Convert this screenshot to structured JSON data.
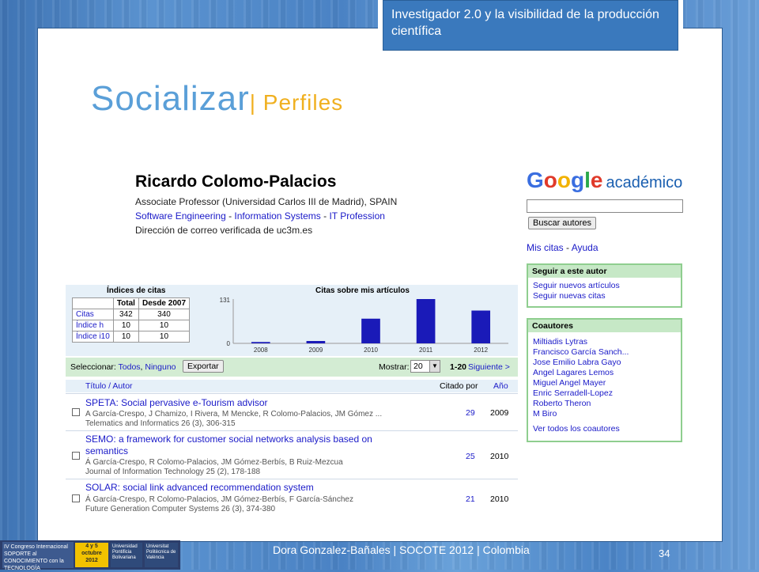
{
  "slide": {
    "header_box": "Investigador 2.0 y la visibilidad de la producción científica",
    "heading_main": "Socializar",
    "heading_sub": "| Perfiles",
    "footer": "Dora Gonzalez-Bañales | SOCOTE 2012 | Colombia",
    "page_number": "34"
  },
  "profile": {
    "name": "Ricardo Colomo-Palacios",
    "affiliation": "Associate Professor (Universidad Carlos III de Madrid), SPAIN",
    "interests": [
      "Software Engineering",
      "Information Systems",
      "IT Profession"
    ],
    "email_verified": "Dirección de correo verificada de uc3m.es"
  },
  "google": {
    "logo_colors": [
      "#3a6ee0",
      "#e03a2a",
      "#f2b200",
      "#3a6ee0",
      "#2aa84a",
      "#e03a2a"
    ],
    "logo_letters": [
      "G",
      "o",
      "o",
      "g",
      "l",
      "e"
    ],
    "logo_suffix": "académico",
    "search_value": "",
    "search_button": "Buscar autores",
    "nav_mis_citas": "Mis citas",
    "nav_sep": "-",
    "nav_ayuda": "Ayuda"
  },
  "follow": {
    "title": "Seguir a este autor",
    "items": [
      "Seguir nuevos artículos",
      "Seguir nuevas citas"
    ]
  },
  "coauthors": {
    "title": "Coautores",
    "items": [
      "Miltiadis Lytras",
      "Francisco García Sanch...",
      "Jose Emilio Labra Gayo",
      "Angel Lagares Lemos",
      "Miguel Angel Mayer",
      "Enric Serradell-Lopez",
      "Roberto Theron",
      "M Biro"
    ],
    "see_all": "Ver todos los coautores"
  },
  "citation_indices": {
    "title": "Índices de citas",
    "headers": [
      "",
      "Total",
      "Desde 2007"
    ],
    "rows": [
      [
        "Citas",
        "342",
        "340"
      ],
      [
        "Índice h",
        "10",
        "10"
      ],
      [
        "Índice i10",
        "10",
        "10"
      ]
    ]
  },
  "chart_data": {
    "type": "bar",
    "title": "Citas sobre mis artículos",
    "categories": [
      "2008",
      "2009",
      "2010",
      "2011",
      "2012"
    ],
    "values": [
      4,
      7,
      73,
      131,
      97
    ],
    "y_ticks": [
      "131",
      "0"
    ],
    "ylim": [
      0,
      131
    ],
    "bar_color": "#1a1ab8"
  },
  "toolbar": {
    "select_label": "Seleccionar:",
    "select_all": "Todos",
    "select_sep": ",",
    "select_none": "Ninguno",
    "export_button": "Exportar",
    "show_label": "Mostrar:",
    "show_value": "20",
    "range": "1-20",
    "next": "Siguiente >"
  },
  "list_headers": {
    "title_author": "Título / Autor",
    "cited_by": "Citado por",
    "year": "Año"
  },
  "articles": [
    {
      "title_lines": [
        "SPETA: Social pervasive e-Tourism advisor"
      ],
      "authors": "A García-Crespo, J Chamizo, I Rivera, M Mencke, R Colomo-Palacios, JM Gómez ...",
      "source": "Telematics and Informatics 26 (3), 306-315",
      "cited": "29",
      "year": "2009"
    },
    {
      "title_lines": [
        "SEMO: a framework for customer social networks analysis based on",
        "semantics"
      ],
      "authors": "Á García-Crespo, R Colomo-Palacios, JM Gómez-Berbís, B Ruiz-Mezcua",
      "source": "Journal of Information Technology 25 (2), 178-188",
      "cited": "25",
      "year": "2010"
    },
    {
      "title_lines": [
        "SOLAR: social link advanced recommendation system"
      ],
      "authors": "Á García-Crespo, R Colomo-Palacios, JM Gómez-Berbís, F García-Sánchez",
      "source": "Future Generation Computer Systems 26 (3), 374-380",
      "cited": "21",
      "year": "2010"
    }
  ],
  "logos": {
    "conf": "IV Congreso Internacional SOPORTE al CONOCIMIENTO con la TECNOLOGÍA",
    "dates": "4 y 5 octubre 2012",
    "uni1": "Universidad Pontificia Bolivariana",
    "uni2": "Universitat Politècnica de València"
  }
}
